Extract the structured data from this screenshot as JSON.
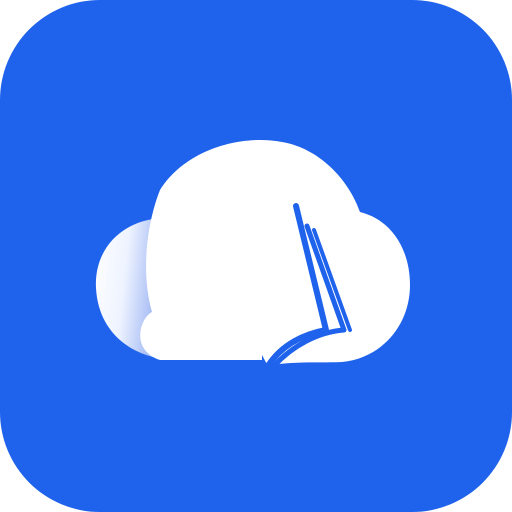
{
  "icon": {
    "name": "cloud-book-app-icon",
    "colors": {
      "background": "#1F63EC",
      "cloud": "#FFFFFF",
      "cloud_shade": "#8FAAF1",
      "book_lines": "#1F63EC"
    }
  }
}
